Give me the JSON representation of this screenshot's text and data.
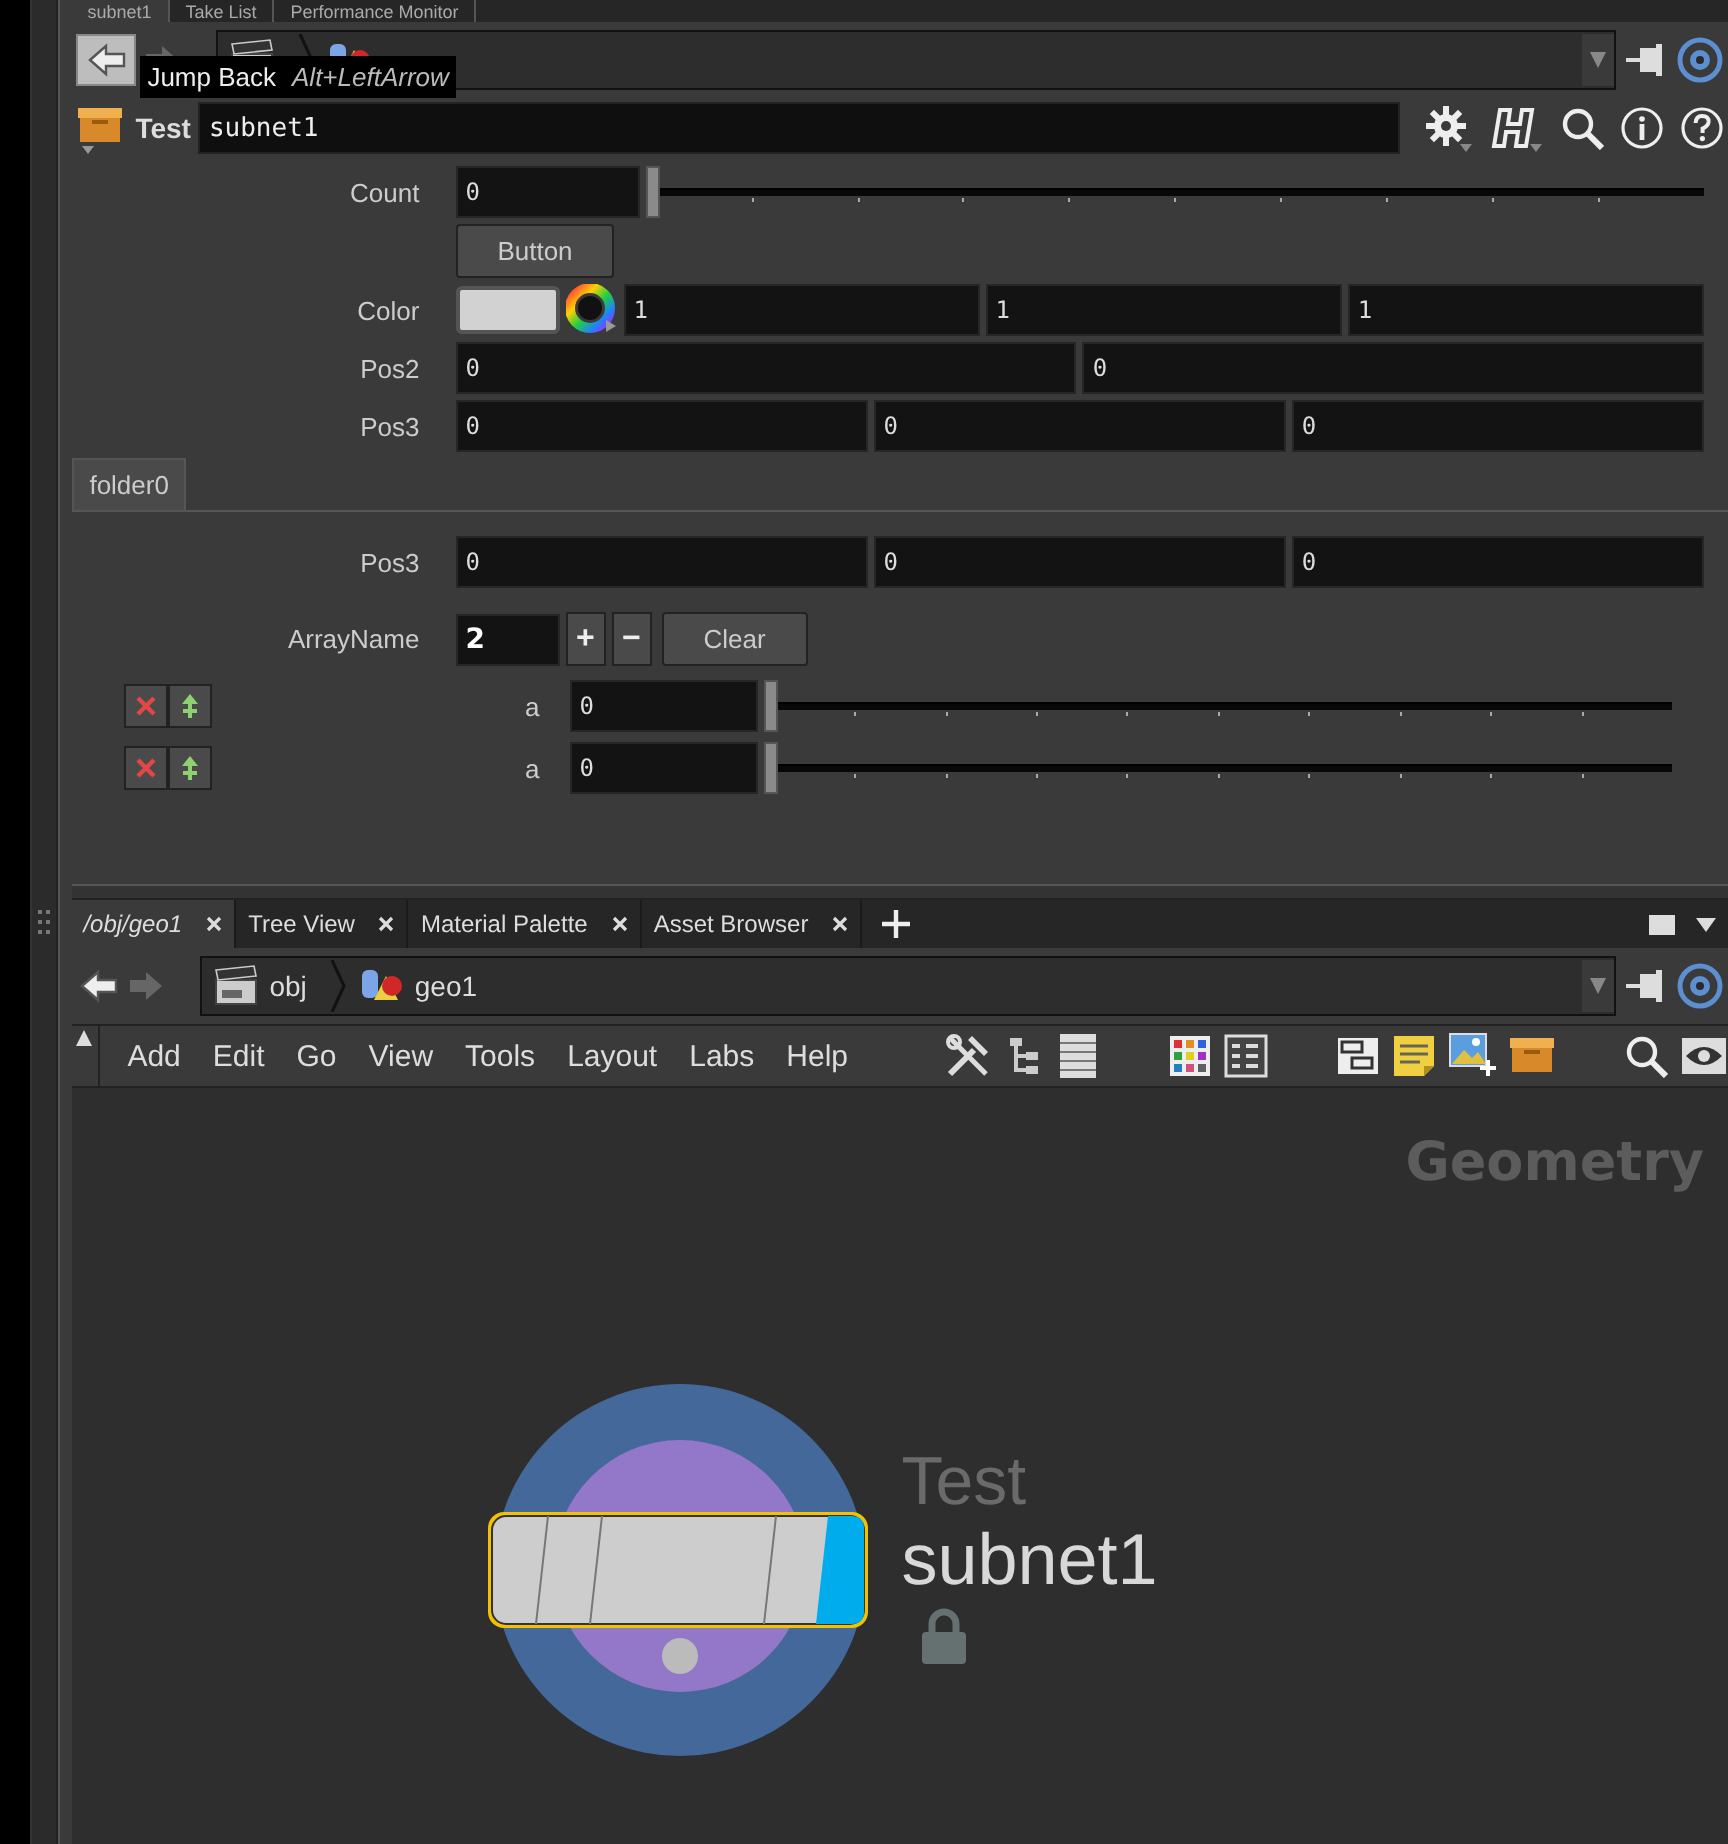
{
  "top_tabs": [
    {
      "label": "subnet1",
      "selected": true
    },
    {
      "label": "Take List",
      "selected": false
    },
    {
      "label": "Performance Monitor",
      "selected": false
    }
  ],
  "tooltip": {
    "label": "Jump Back",
    "shortcut": "Alt+LeftArrow"
  },
  "param_header": {
    "type": "Test",
    "name": "subnet1"
  },
  "params": [
    {
      "kind": "slider",
      "label": "Count",
      "value": "0",
      "level": 0
    },
    {
      "kind": "button",
      "label": "Button"
    },
    {
      "kind": "color",
      "label": "Color",
      "values": [
        "1",
        "1",
        "1"
      ]
    },
    {
      "kind": "vector",
      "label": "Pos2",
      "values": [
        "0",
        "0"
      ]
    },
    {
      "kind": "vector",
      "label": "Pos3",
      "values": [
        "0",
        "0",
        "0"
      ]
    }
  ],
  "folder": {
    "tabs": [
      {
        "label": "folder0",
        "selected": true
      }
    ],
    "params": [
      {
        "kind": "vector",
        "label": "Pos3",
        "values": [
          "0",
          "0",
          "0"
        ]
      },
      {
        "kind": "multiparm",
        "label": "ArrayName",
        "value": "2",
        "add": "+",
        "remove": "−",
        "clear": "Clear",
        "instances": [
          {
            "label": "a",
            "value": "0",
            "level": 0
          },
          {
            "label": "a",
            "value": "0",
            "level": 0
          }
        ]
      }
    ]
  },
  "network": {
    "tabs": [
      {
        "label": "/obj/geo1",
        "selected": true
      },
      {
        "label": "Tree View",
        "selected": false
      },
      {
        "label": "Material Palette",
        "selected": false
      },
      {
        "label": "Asset Browser",
        "selected": false
      }
    ],
    "path": [
      "obj",
      "geo1"
    ],
    "menu": [
      "Add",
      "Edit",
      "Go",
      "View",
      "Tools",
      "Layout",
      "Labs",
      "Help"
    ],
    "context_label": "Geometry",
    "node": {
      "type": "Test",
      "name": "subnet1",
      "selected": true,
      "locked": true
    }
  }
}
